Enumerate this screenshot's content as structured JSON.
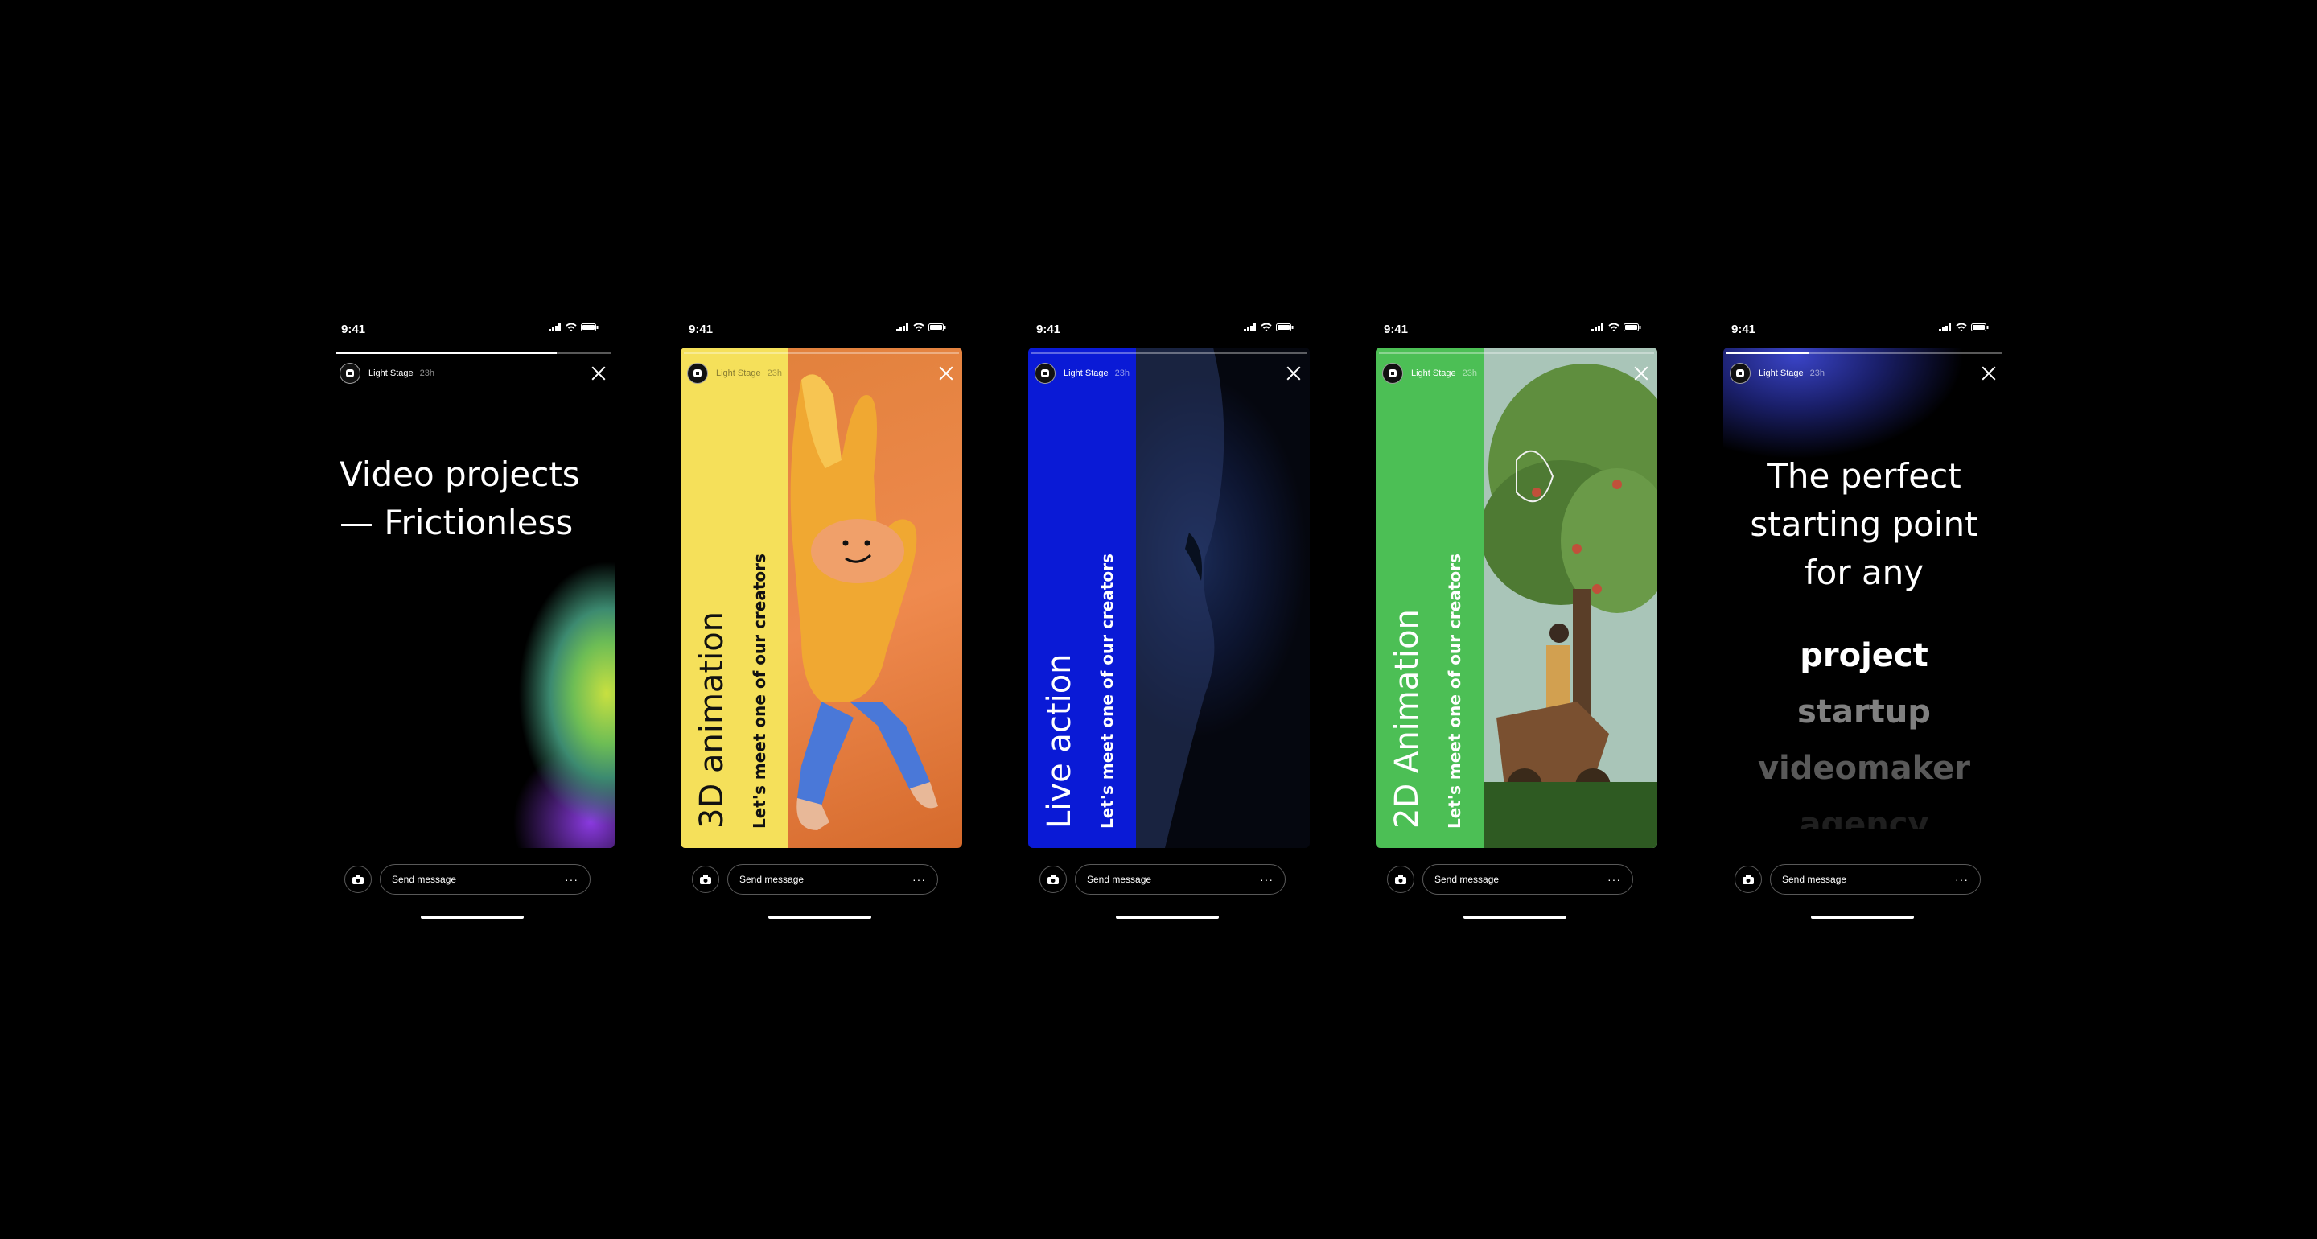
{
  "status_time": "9:41",
  "account_name": "Light Stage",
  "story_age": "23h",
  "message_placeholder": "Send message",
  "more_glyph": "···",
  "phones": [
    {
      "headline_lines": [
        "Video projects",
        "— Frictionless"
      ],
      "progress": 0.8
    },
    {
      "title": "3D animation",
      "subtitle": "Let's meet one of our creators",
      "bar_color": "#f5e05a",
      "progress": 0.0
    },
    {
      "title": "Live action",
      "subtitle": "Let's meet one of our creators",
      "bar_color": "#0a1ad6",
      "progress": 0.0
    },
    {
      "title": "2D Animation",
      "subtitle": "Let's meet one of our creators",
      "bar_color": "#4cbf55",
      "progress": 0.0
    },
    {
      "headline_lines": [
        "The perfect",
        "starting point",
        "for any"
      ],
      "words": [
        "project",
        "startup",
        "videomaker",
        "agency"
      ],
      "progress": 0.3
    }
  ]
}
